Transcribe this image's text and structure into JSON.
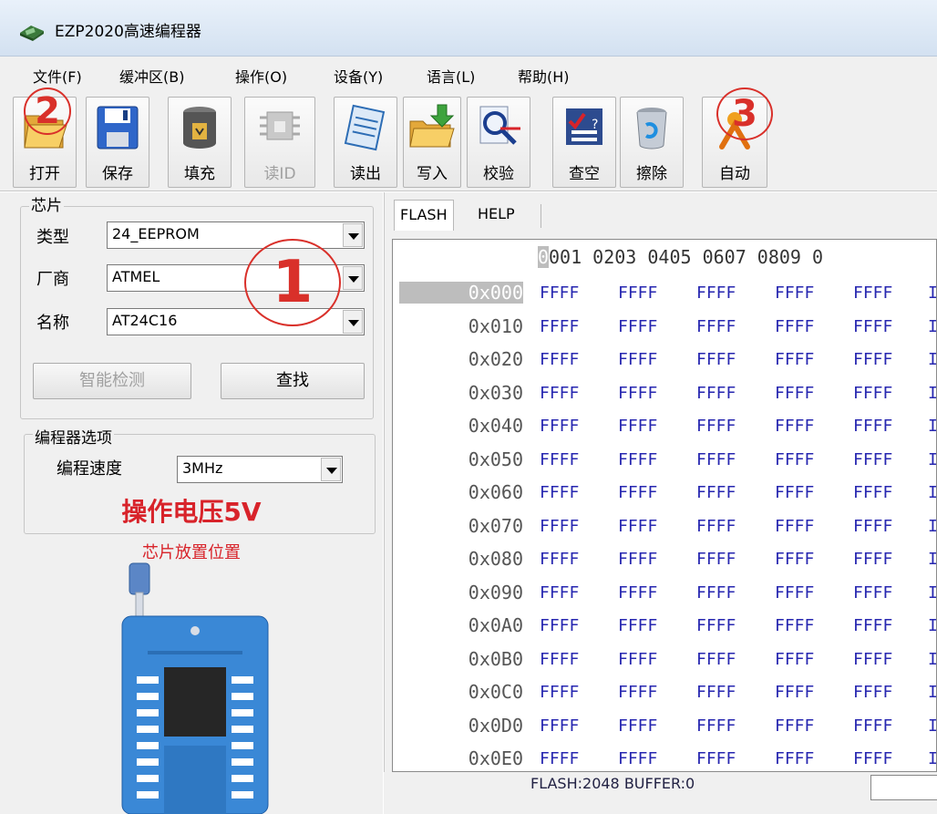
{
  "window": {
    "title": "EZP2020高速编程器"
  },
  "menu": [
    "文件(F)",
    "缓冲区(B)",
    "操作(O)",
    "设备(Y)",
    "语言(L)",
    "帮助(H)"
  ],
  "toolbar": {
    "open": "打开",
    "save": "保存",
    "fill": "填充",
    "read_id": "读ID",
    "read": "读出",
    "write": "写入",
    "verify": "校验",
    "blank_check": "查空",
    "erase": "擦除",
    "auto": "自动"
  },
  "annotations": {
    "one": "1",
    "two": "2",
    "three": "3"
  },
  "chip": {
    "group_title": "芯片",
    "type_label": "类型",
    "type_value": "24_EEPROM",
    "maker_label": "厂商",
    "maker_value": "ATMEL",
    "name_label": "名称",
    "name_value": "AT24C16",
    "smart_detect": "智能检测",
    "search": "查找"
  },
  "programmer": {
    "group_title": "编程器选项",
    "speed_label": "编程速度",
    "speed_value": "3MHz"
  },
  "voltage_text": "操作电压5V",
  "chip_position_text": "芯片放置位置",
  "tabs": [
    "FLASH",
    "HELP"
  ],
  "hex": {
    "header_cursor": "0",
    "header_rest": "001 0203 0405 0607 0809 0",
    "addresses": [
      "0x000",
      "0x010",
      "0x020",
      "0x030",
      "0x040",
      "0x050",
      "0x060",
      "0x070",
      "0x080",
      "0x090",
      "0x0A0",
      "0x0B0",
      "0x0C0",
      "0x0D0",
      "0x0E0"
    ],
    "cell_value": "FFFF",
    "cell_tail": "I"
  },
  "status": {
    "text": "FLASH:2048 BUFFER:0"
  }
}
